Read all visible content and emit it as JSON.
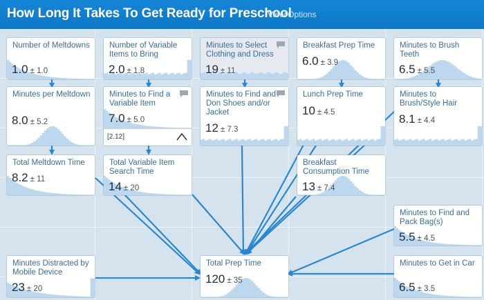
{
  "header": {
    "title": "How Long It Takes To Get Ready for Preschool",
    "view_options": "View Options"
  },
  "colors": {
    "header_bg": "#1480d1",
    "grid_bg": "#d5e3ee",
    "card_title": "#3a6d99",
    "arrow": "#2a86cf",
    "histogram": "#bcd7ee"
  },
  "cards": [
    {
      "id": "melt",
      "title": "Number of Meltdowns",
      "mean": "1.0",
      "sd": "± 1.0",
      "shape": "decay",
      "comment": false
    },
    {
      "id": "varitems",
      "title": "Number of Variable Items to Bring",
      "mean": "2.0",
      "sd": "± 1.8",
      "shape": "flat_spike",
      "comment": false
    },
    {
      "id": "clothing",
      "title": "Minutes to Select Clothing and Dress",
      "mean": "19",
      "sd": "± 11",
      "shape": "flat",
      "comment": true
    },
    {
      "id": "bfprep",
      "title": "Breakfast Prep Time",
      "mean": "6.0",
      "sd": "± 3.9",
      "shape": "normal",
      "comment": false
    },
    {
      "id": "brush",
      "title": "Minutes to Brush Teeth",
      "mean": "6.5",
      "sd": "± 5.5",
      "shape": "normal_wide",
      "comment": false
    },
    {
      "id": "minmelt",
      "title": "Minutes per Meltdown",
      "mean": "8.0",
      "sd": "± 5.2",
      "shape": "normal",
      "comment": false
    },
    {
      "id": "findvar",
      "title": "Minutes to Find a Variable Item",
      "mean": "7.0",
      "sd": "± 5.0",
      "shape": "decay",
      "comment": true,
      "range": "[2.12]"
    },
    {
      "id": "shoes",
      "title": "Minutes to Find and Don Shoes and/or Jacket",
      "mean": "12",
      "sd": "± 7.3",
      "shape": "flat_spike",
      "comment": true
    },
    {
      "id": "lunch",
      "title": "Lunch Prep Time",
      "mean": "10",
      "sd": "± 4.5",
      "shape": "flat_spike",
      "comment": false
    },
    {
      "id": "hair",
      "title": "Minutes to Brush/Style Hair",
      "mean": "8.1",
      "sd": "± 4.4",
      "shape": "flat_spike",
      "comment": false
    },
    {
      "id": "totmelt",
      "title": "Total Meltdown Time",
      "mean": "8.2",
      "sd": "± 11",
      "shape": "decay",
      "comment": false
    },
    {
      "id": "totsearch",
      "title": "Total Variable Item Search Time",
      "mean": "14",
      "sd": "± 20",
      "shape": "decay",
      "comment": false
    },
    {
      "id": "bfcons",
      "title": "Breakfast Consumption Time",
      "mean": "13",
      "sd": "± 7.4",
      "shape": "normal",
      "comment": false
    },
    {
      "id": "bags",
      "title": "Minutes to Find and Pack Bag(s)",
      "mean": "5.5",
      "sd": "± 4.5",
      "shape": "decay",
      "comment": false
    },
    {
      "id": "mobile",
      "title": "Minutes Distracted by Mobile Device",
      "mean": "23",
      "sd": "± 20",
      "shape": "decay_spike",
      "comment": false
    },
    {
      "id": "total",
      "title": "Total Prep Time",
      "mean": "120",
      "sd": "± 35",
      "shape": "normal",
      "comment": false
    },
    {
      "id": "car",
      "title": "Minutes to Get in Car",
      "mean": "6.5",
      "sd": "± 3.5",
      "shape": "decay",
      "comment": false
    }
  ]
}
